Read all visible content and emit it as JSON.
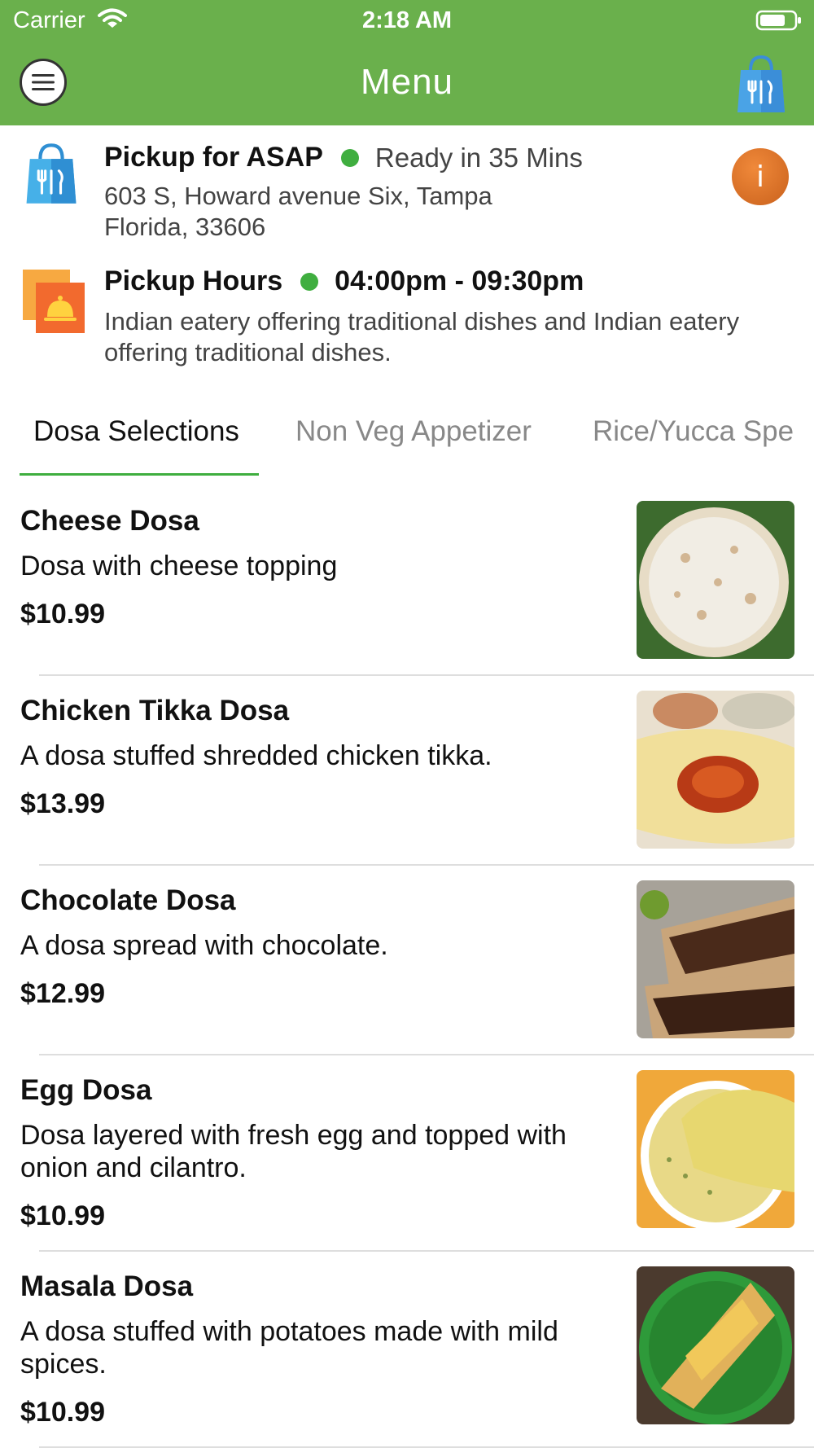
{
  "status_bar": {
    "carrier": "Carrier",
    "time": "2:18 AM"
  },
  "nav": {
    "title": "Menu",
    "menu_icon": "hamburger-icon",
    "cart_icon": "shopping-bag-icon"
  },
  "pickup": {
    "title": "Pickup for ASAP",
    "ready": "Ready in 35 Mins",
    "address_line1": "603 S, Howard avenue Six, Tampa",
    "address_line2": "Florida, 33606",
    "info_label": "i"
  },
  "hours": {
    "title": "Pickup Hours",
    "range": "04:00pm - 09:30pm",
    "description": "Indian eatery offering traditional dishes and Indian eatery offering traditional dishes."
  },
  "tabs": [
    {
      "label": "Dosa Selections",
      "active": true
    },
    {
      "label": "Non Veg Appetizer",
      "active": false
    },
    {
      "label": "Rice/Yucca Spe",
      "active": false
    }
  ],
  "menu_items": [
    {
      "name": "Cheese Dosa",
      "description": "Dosa with cheese topping",
      "price": "$10.99"
    },
    {
      "name": "Chicken Tikka Dosa",
      "description": "A dosa stuffed shredded chicken tikka.",
      "price": "$13.99"
    },
    {
      "name": "Chocolate Dosa",
      "description": "A dosa spread with chocolate.",
      "price": "$12.99"
    },
    {
      "name": "Egg Dosa",
      "description": "Dosa layered with fresh egg and topped with onion and cilantro.",
      "price": "$10.99"
    },
    {
      "name": "Masala Dosa",
      "description": "A dosa stuffed with potatoes made with mild spices.",
      "price": "$10.99"
    }
  ],
  "colors": {
    "header_green": "#6ab04c",
    "status_dot": "#3fae3f",
    "info_orange": "#e07a2b",
    "tab_underline": "#3fae3f"
  }
}
